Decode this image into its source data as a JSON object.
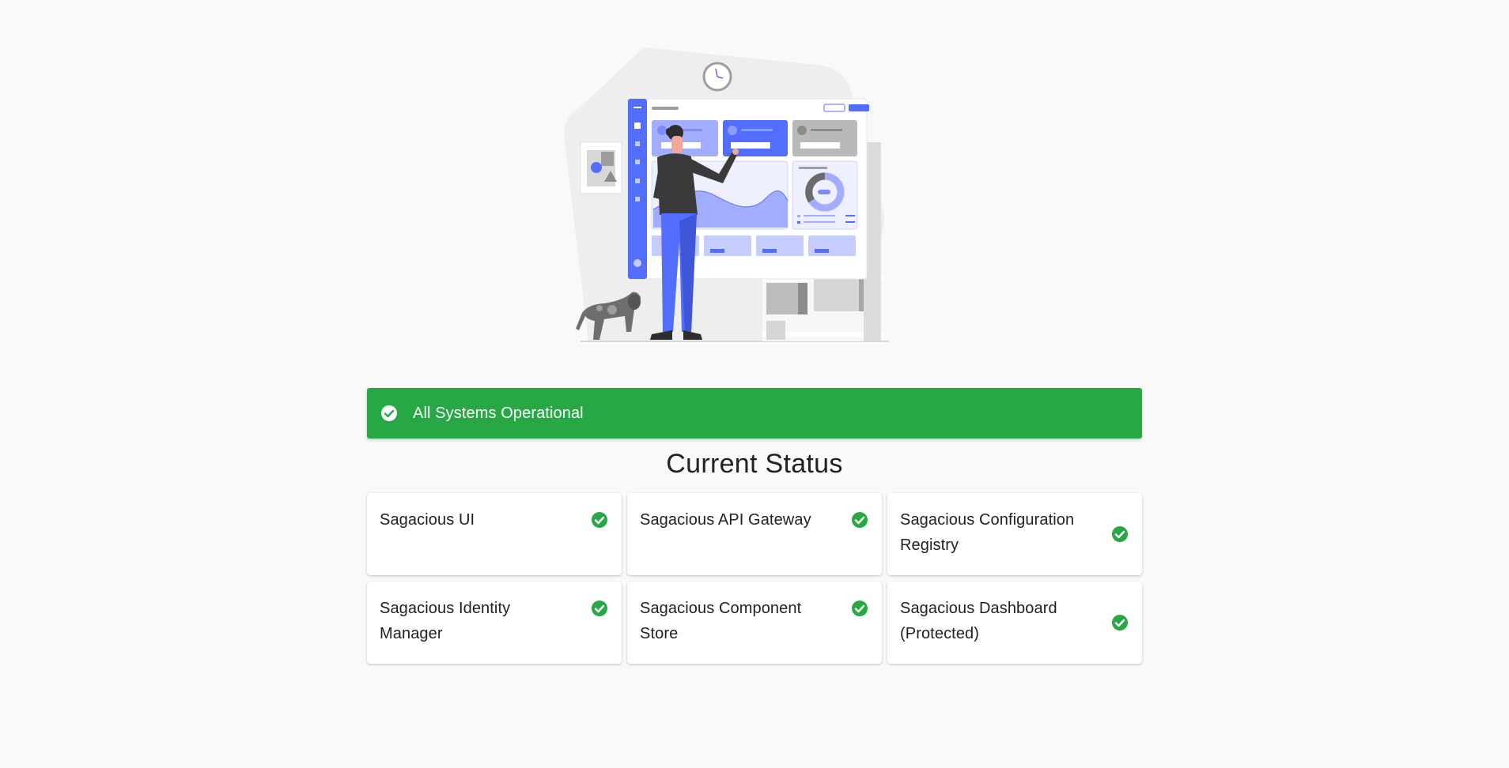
{
  "banner": {
    "text": "All Systems Operational",
    "icon": "check-circle-icon",
    "color": "#28a745"
  },
  "main": {
    "title": "Current Status"
  },
  "services": [
    {
      "name": "Sagacious UI",
      "status_icon": "check-circle-icon"
    },
    {
      "name": "Sagacious API Gateway",
      "status_icon": "check-circle-icon"
    },
    {
      "name": "Sagacious Configuration Registry",
      "status_icon": "check-circle-icon"
    },
    {
      "name": "Sagacious Identity Manager",
      "status_icon": "check-circle-icon"
    },
    {
      "name": "Sagacious Component Store",
      "status_icon": "check-circle-icon"
    },
    {
      "name": "Sagacious Dashboard (Protected)",
      "status_icon": "check-circle-icon"
    }
  ],
  "colors": {
    "background": "#f9f9f9",
    "success": "#28a745",
    "accent": "#536dfe"
  }
}
